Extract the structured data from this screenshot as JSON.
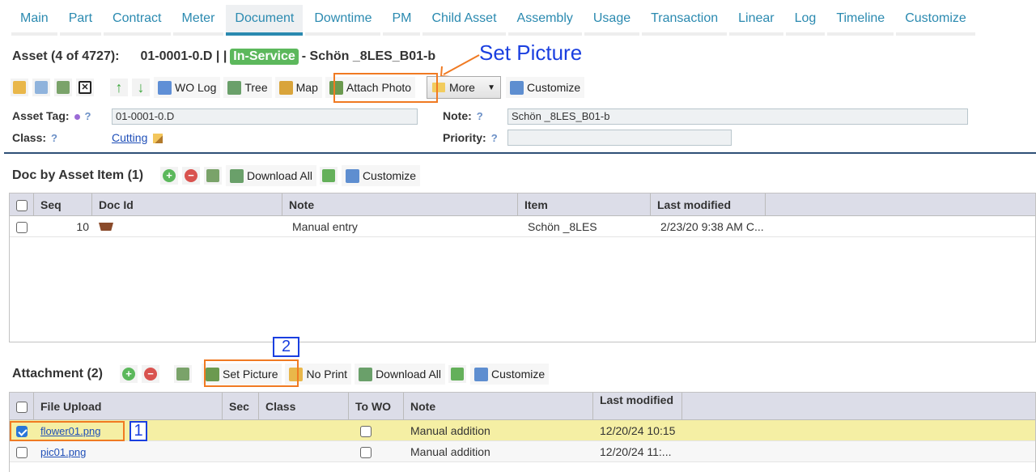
{
  "tabs": [
    "Main",
    "Part",
    "Contract",
    "Meter",
    "Document",
    "Downtime",
    "PM",
    "Child Asset",
    "Assembly",
    "Usage",
    "Transaction",
    "Linear",
    "Log",
    "Timeline",
    "Customize"
  ],
  "active_tab": "Document",
  "header": {
    "position": "Asset (4 of 4727):",
    "code": "01-0001-0.D | |",
    "status": "In-Service",
    "name": "- Schön _8LES_B01-b"
  },
  "annotation": {
    "set_picture": "Set Picture",
    "step1": "1",
    "step2": "2"
  },
  "toolbar": {
    "wo_log": "WO Log",
    "tree": "Tree",
    "map": "Map",
    "attach_photo": "Attach Photo",
    "more": "More",
    "customize": "Customize"
  },
  "fields": {
    "asset_tag_label": "Asset Tag:",
    "asset_tag_value": "01-0001-0.D",
    "class_label": "Class:",
    "class_value": "Cutting",
    "note_label": "Note:",
    "note_value": "Schön  _8LES_B01-b",
    "priority_label": "Priority:",
    "priority_value": "",
    "help": "?"
  },
  "doc_section": {
    "title": "Doc by Asset Item (1)",
    "download_all": "Download All",
    "customize": "Customize",
    "columns": [
      "Seq",
      "Doc Id",
      "Note",
      "Item",
      "Last modified"
    ],
    "rows": [
      {
        "seq": "10",
        "note": "Manual entry",
        "item": "Schön _8LES",
        "last_modified": "2/23/20 9:38 AM C..."
      }
    ]
  },
  "attach_section": {
    "title": "Attachment (2)",
    "set_picture": "Set Picture",
    "no_print": "No Print",
    "download_all": "Download All",
    "customize": "Customize",
    "columns": [
      "File Upload",
      "Sec",
      "Class",
      "To WO",
      "Note",
      "Last modified"
    ],
    "rows": [
      {
        "file": "flower01.png",
        "note": "Manual addition",
        "last_modified": "12/20/24 10:15",
        "checked": true
      },
      {
        "file": "pic01.png",
        "note": "Manual addition",
        "last_modified": "12/20/24 11:...",
        "checked": false
      }
    ]
  },
  "colors": {
    "accent": "#2b8ab0",
    "status_green": "#5cb85c",
    "annotation_orange": "#f07a22",
    "annotation_blue": "#1a3fe0",
    "selected_row": "#f5efa4"
  }
}
